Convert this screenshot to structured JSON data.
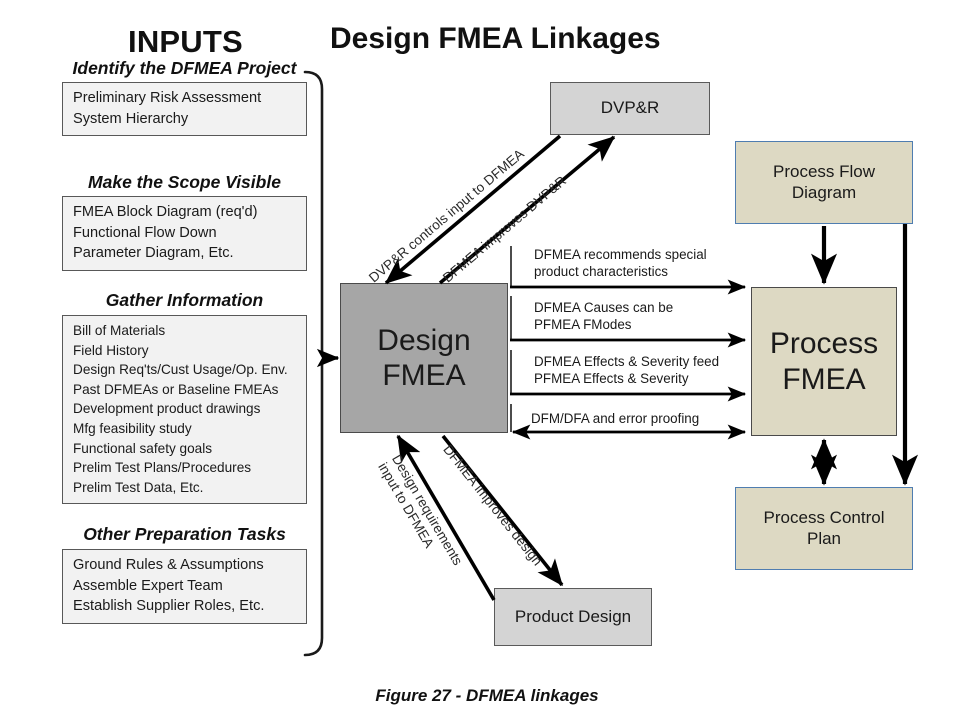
{
  "titles": {
    "inputs": "INPUTS",
    "main": "Design FMEA Linkages",
    "caption": "Figure 27 - DFMEA linkages"
  },
  "colors": {
    "design_fmea_fill": "#a6a6a6",
    "dvpr_fill": "#d4d4d4",
    "product_design_fill": "#d4d4d4",
    "process_box_fill": "#ddd9c3",
    "process_box_border": "#4f7db0",
    "group_box_fill": "#f2f2f2",
    "group_box_border": "#585858",
    "arrow": "#000000"
  },
  "inputs_groups": [
    {
      "heading": "Identify the DFMEA Project",
      "items": [
        "Preliminary Risk Assessment",
        "System Hierarchy"
      ]
    },
    {
      "heading": "Make the Scope Visible",
      "items": [
        "FMEA Block Diagram (req'd)",
        "Functional Flow Down",
        "Parameter Diagram, Etc."
      ]
    },
    {
      "heading": "Gather Information",
      "items": [
        "Bill of Materials",
        "Field History",
        "Design Req'ts/Cust Usage/Op. Env.",
        "Past DFMEAs or Baseline FMEAs",
        "Development product drawings",
        "Mfg feasibility study",
        "Functional safety goals",
        "Prelim Test Plans/Procedures",
        "Prelim Test Data, Etc."
      ]
    },
    {
      "heading": "Other Preparation Tasks",
      "items": [
        "Ground Rules & Assumptions",
        "Assemble Expert Team",
        "Establish Supplier Roles, Etc."
      ]
    }
  ],
  "nodes": {
    "dvpr": "DVP&R",
    "design_fmea_line1": "Design",
    "design_fmea_line2": "FMEA",
    "product_design": "Product Design",
    "process_flow_line1": "Process Flow",
    "process_flow_line2": "Diagram",
    "process_fmea_line1": "Process",
    "process_fmea_line2": "FMEA",
    "process_control_line1": "Process Control",
    "process_control_line2": "Plan"
  },
  "diagonal_labels": {
    "dvpr_controls": "DVP&R controls input to DFMEA",
    "dfmea_improves_dvpr": "DFMEA improves DVP&R",
    "design_req_line1": "Design requirements",
    "design_req_line2": "input to DFMEA",
    "dfmea_improves_design": "DFMEA improves design"
  },
  "center_arrows": [
    {
      "line1": "DFMEA recommends special",
      "line2": "product characteristics",
      "direction": "right"
    },
    {
      "line1": "DFMEA Causes can be",
      "line2": "PFMEA FModes",
      "direction": "right"
    },
    {
      "line1": "DFMEA Effects & Severity feed",
      "line2": "PFMEA Effects & Severity",
      "direction": "right"
    },
    {
      "line1": "DFM/DFA and error proofing",
      "line2": "",
      "direction": "both"
    }
  ]
}
